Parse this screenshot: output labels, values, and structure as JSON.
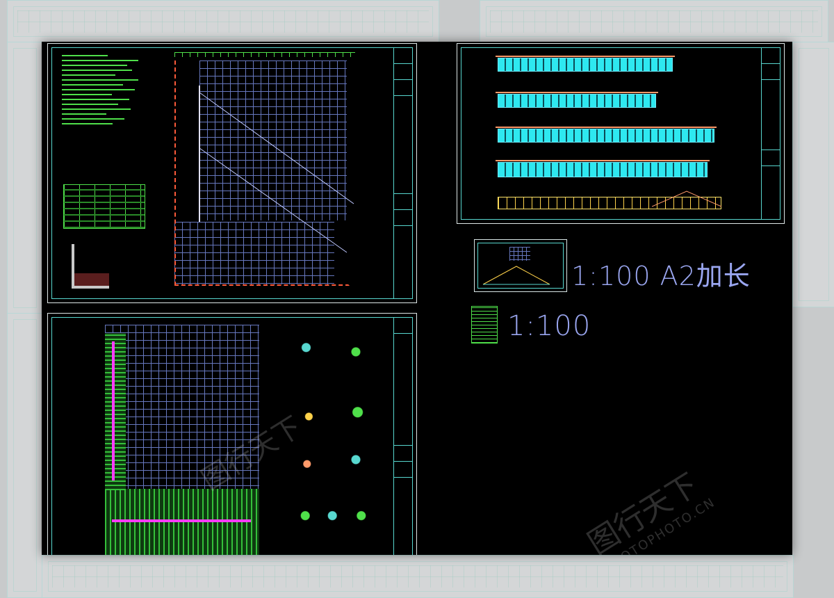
{
  "drawing": {
    "scale_a2_extended": "1:100 A2加长",
    "scale_standard": "1:100"
  },
  "watermark": {
    "brand": "图行天下",
    "site": "PHOTOPHOTO.CN"
  },
  "colors": {
    "background": "#000000",
    "frame": "#58d8d0",
    "grid": "#8aa0ff",
    "annotation_green": "#4fe04a",
    "elevation_cyan": "#2ee8f0",
    "highlight_magenta": "#ff3cff",
    "accent_red": "#ff5a3a"
  }
}
